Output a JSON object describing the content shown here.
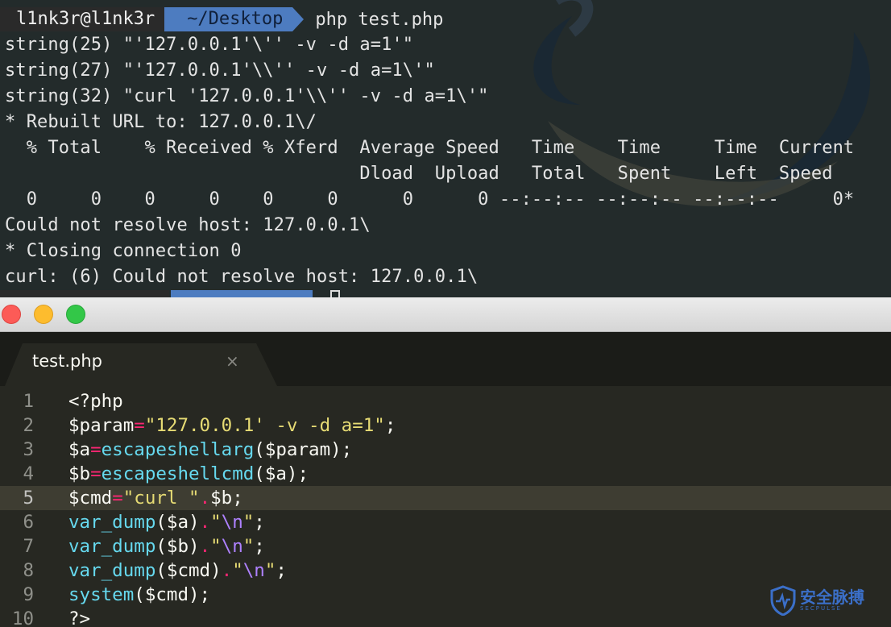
{
  "terminal": {
    "prompt": {
      "user": "l1nk3r@l1nk3r",
      "dir": "~/Desktop",
      "command": "php test.php"
    },
    "output": [
      "string(25) \"'127.0.0.1'\\'' -v -d a=1'\"",
      "string(27) \"'127.0.0.1'\\\\'' -v -d a=1\\'\"",
      "string(32) \"curl '127.0.0.1'\\\\'' -v -d a=1\\'\"",
      "* Rebuilt URL to: 127.0.0.1\\/",
      "  % Total    % Received % Xferd  Average Speed   Time    Time     Time  Current",
      "                                 Dload  Upload   Total   Spent    Left  Speed",
      "  0     0    0     0    0     0      0      0 --:--:-- --:--:-- --:--:--     0*",
      "Could not resolve host: 127.0.0.1\\",
      "* Closing connection 0",
      "curl: (6) Could not resolve host: 127.0.0.1\\"
    ]
  },
  "editor": {
    "tab": {
      "label": "test.php",
      "close": "×"
    },
    "active_line": 5,
    "lines": [
      {
        "n": "1",
        "parts": [
          {
            "t": "<?php",
            "c": ""
          }
        ]
      },
      {
        "n": "2",
        "parts": [
          {
            "t": "$param",
            "c": ""
          },
          {
            "t": "=",
            "c": "op"
          },
          {
            "t": "\"127.0.0.1' -v -d a=1\"",
            "c": "str"
          },
          {
            "t": ";",
            "c": ""
          }
        ]
      },
      {
        "n": "3",
        "parts": [
          {
            "t": "$a",
            "c": ""
          },
          {
            "t": "=",
            "c": "op"
          },
          {
            "t": "escapeshellarg",
            "c": "fn"
          },
          {
            "t": "($param);",
            "c": ""
          }
        ]
      },
      {
        "n": "4",
        "parts": [
          {
            "t": "$b",
            "c": ""
          },
          {
            "t": "=",
            "c": "op"
          },
          {
            "t": "escapeshellcmd",
            "c": "fn"
          },
          {
            "t": "($a);",
            "c": ""
          }
        ]
      },
      {
        "n": "5",
        "parts": [
          {
            "t": "$cmd",
            "c": ""
          },
          {
            "t": "=",
            "c": "op"
          },
          {
            "t": "\"curl \"",
            "c": "str"
          },
          {
            "t": ".",
            "c": "op"
          },
          {
            "t": "$b;",
            "c": ""
          }
        ]
      },
      {
        "n": "6",
        "parts": [
          {
            "t": "var_dump",
            "c": "fn"
          },
          {
            "t": "($a)",
            "c": ""
          },
          {
            "t": ".",
            "c": "op"
          },
          {
            "t": "\"",
            "c": "str"
          },
          {
            "t": "\\n",
            "c": "esc"
          },
          {
            "t": "\"",
            "c": "str"
          },
          {
            "t": ";",
            "c": ""
          }
        ]
      },
      {
        "n": "7",
        "parts": [
          {
            "t": "var_dump",
            "c": "fn"
          },
          {
            "t": "($b)",
            "c": ""
          },
          {
            "t": ".",
            "c": "op"
          },
          {
            "t": "\"",
            "c": "str"
          },
          {
            "t": "\\n",
            "c": "esc"
          },
          {
            "t": "\"",
            "c": "str"
          },
          {
            "t": ";",
            "c": ""
          }
        ]
      },
      {
        "n": "8",
        "parts": [
          {
            "t": "var_dump",
            "c": "fn"
          },
          {
            "t": "($cmd)",
            "c": ""
          },
          {
            "t": ".",
            "c": "op"
          },
          {
            "t": "\"",
            "c": "str"
          },
          {
            "t": "\\n",
            "c": "esc"
          },
          {
            "t": "\"",
            "c": "str"
          },
          {
            "t": ";",
            "c": ""
          }
        ]
      },
      {
        "n": "9",
        "parts": [
          {
            "t": "system",
            "c": "fn"
          },
          {
            "t": "($cmd);",
            "c": ""
          }
        ]
      },
      {
        "n": "10",
        "parts": [
          {
            "t": "?>",
            "c": ""
          }
        ]
      }
    ]
  },
  "watermark": {
    "text": "安全脉搏",
    "subtext": "SECPULSE"
  },
  "colors": {
    "terminal_bg": "#232b2b",
    "prompt_dir_bg": "#4d7cc0",
    "editor_bg": "#272822",
    "string": "#e6db74",
    "operator": "#f92672",
    "function": "#66d9ef",
    "escape": "#ae81ff"
  },
  "icons": [
    "close-window-icon",
    "minimize-window-icon",
    "maximize-window-icon",
    "tab-close-icon",
    "secpulse-shield-icon"
  ]
}
